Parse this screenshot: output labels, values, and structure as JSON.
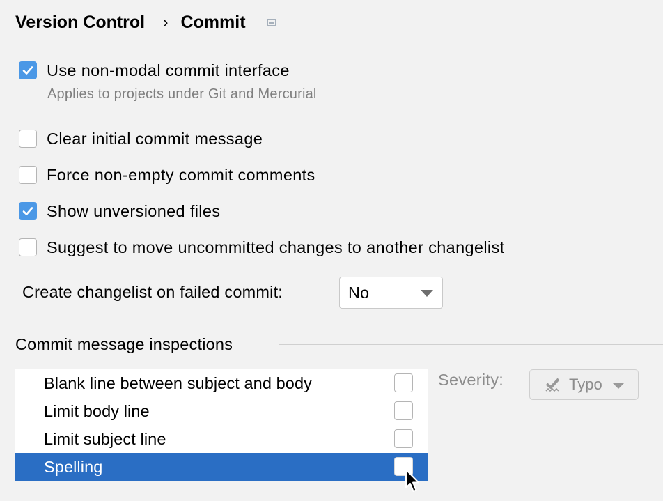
{
  "breadcrumb": {
    "parent": "Version Control",
    "separator": "›",
    "current": "Commit",
    "pin_icon": "window-pin-icon"
  },
  "options": [
    {
      "label": "Use non-modal commit interface",
      "checked": true,
      "hint": "Applies to projects under Git and Mercurial"
    },
    {
      "label": "Clear initial commit message",
      "checked": false
    },
    {
      "label": "Force non-empty commit comments",
      "checked": false
    },
    {
      "label": "Show unversioned files",
      "checked": true
    },
    {
      "label": "Suggest to move uncommitted changes to another changelist",
      "checked": false
    }
  ],
  "changelist": {
    "label": "Create changelist on failed commit:",
    "value": "No"
  },
  "inspections": {
    "title": "Commit message inspections",
    "items": [
      {
        "label": "Blank line between subject and body",
        "checked": false,
        "selected": false
      },
      {
        "label": "Limit body line",
        "checked": false,
        "selected": false
      },
      {
        "label": "Limit subject line",
        "checked": false,
        "selected": false
      },
      {
        "label": "Spelling",
        "checked": false,
        "selected": true
      }
    ],
    "severity_label": "Severity:",
    "severity_value": "Typo",
    "severity_icon": "typo-check-icon"
  },
  "colors": {
    "accent": "#4b98e6",
    "selection": "#2a6ec4",
    "background": "#f2f2f2"
  }
}
